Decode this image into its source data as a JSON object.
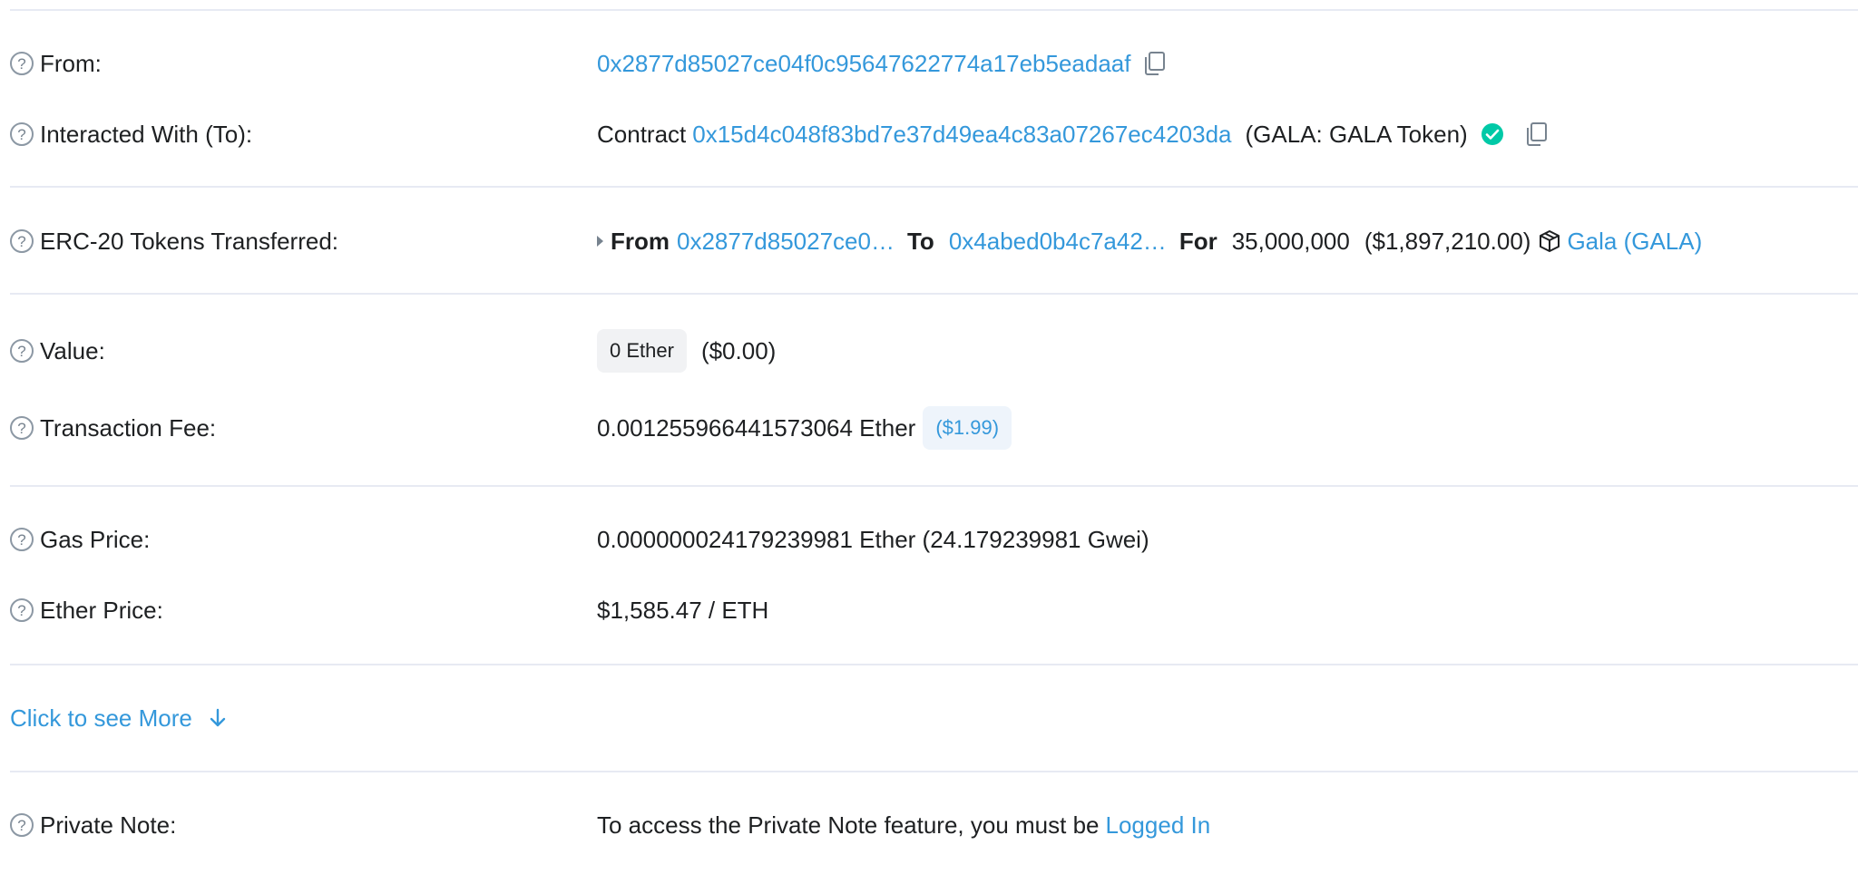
{
  "rows": {
    "from": {
      "label": "From:",
      "address": "0x2877d85027ce04f0c95647622774a17eb5eadaaf"
    },
    "to": {
      "label": "Interacted With (To):",
      "prefix": "Contract",
      "address": "0x15d4c048f83bd7e37d49ea4c83a07267ec4203da",
      "name": "(GALA: GALA Token)"
    },
    "tokens": {
      "label": "ERC-20 Tokens Transferred:",
      "from_word": "From",
      "from_address": "0x2877d85027ce0…",
      "to_word": "To",
      "to_address": "0x4abed0b4c7a42…",
      "for_word": "For",
      "amount": "35,000,000",
      "usd": "($1,897,210.00)",
      "token_link": "Gala (GALA)"
    },
    "value": {
      "label": "Value:",
      "badge": "0 Ether",
      "usd": "($0.00)"
    },
    "fee": {
      "label": "Transaction Fee:",
      "amount": "0.001255966441573064 Ether",
      "usd": "($1.99)"
    },
    "gas_price": {
      "label": "Gas Price:",
      "value": "0.000000024179239981 Ether (24.179239981 Gwei)"
    },
    "ether_price": {
      "label": "Ether Price:",
      "value": "$1,585.47 / ETH"
    },
    "more": {
      "label": "Click to see More"
    },
    "private_note": {
      "label": "Private Note:",
      "text": "To access the Private Note feature, you must be",
      "link": "Logged In"
    }
  },
  "icons": {
    "help": "question-circle",
    "copy": "copy",
    "verified": "check-circle",
    "token": "cube",
    "expand": "arrow-down",
    "caret": "caret-right"
  },
  "colors": {
    "link": "#3498db",
    "verified": "#00c9a7",
    "divider": "#e7eaf3"
  }
}
